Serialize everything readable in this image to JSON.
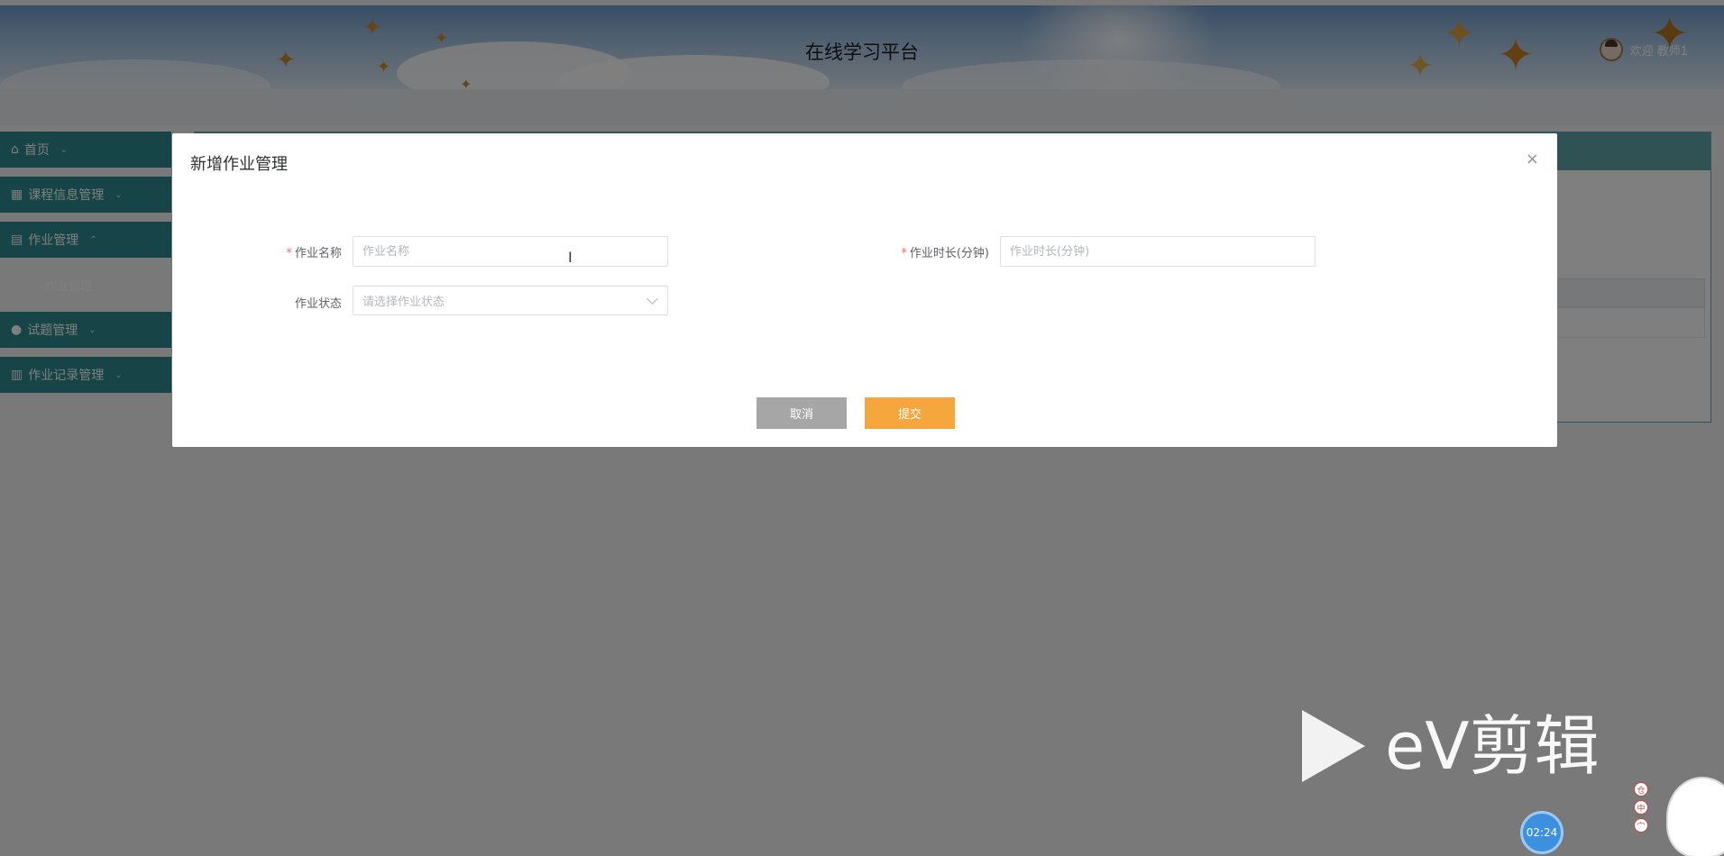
{
  "header": {
    "title": "在线学习平台",
    "welcome": "欢迎 教师1"
  },
  "sidebar": {
    "items": [
      {
        "label": "首页",
        "icon": "home-icon"
      },
      {
        "label": "课程信息管理",
        "icon": "grid-icon"
      },
      {
        "label": "作业管理",
        "icon": "folder-icon"
      },
      {
        "label": "试题管理",
        "icon": "circle-icon"
      },
      {
        "label": "作业记录管理",
        "icon": "book-icon"
      }
    ],
    "sub_item": "作业管理"
  },
  "dialog": {
    "title": "新增作业管理",
    "close": "×",
    "fields": {
      "name_label": "作业名称",
      "name_placeholder": "作业名称",
      "duration_label": "作业时长(分钟)",
      "duration_placeholder": "作业时长(分钟)",
      "status_label": "作业状态",
      "status_placeholder": "请选择作业状态"
    },
    "cancel_label": "取消",
    "submit_label": "提交"
  },
  "watermark": {
    "brand": "eV剪辑",
    "timer": "02:24",
    "mini_icons": [
      "仓",
      "中",
      "宀"
    ]
  },
  "colors": {
    "sidebar": "#2e8b8f",
    "cancel_button": "#a6a6a6",
    "submit_button": "#f5a63c",
    "required_mark": "#f56c6c"
  }
}
